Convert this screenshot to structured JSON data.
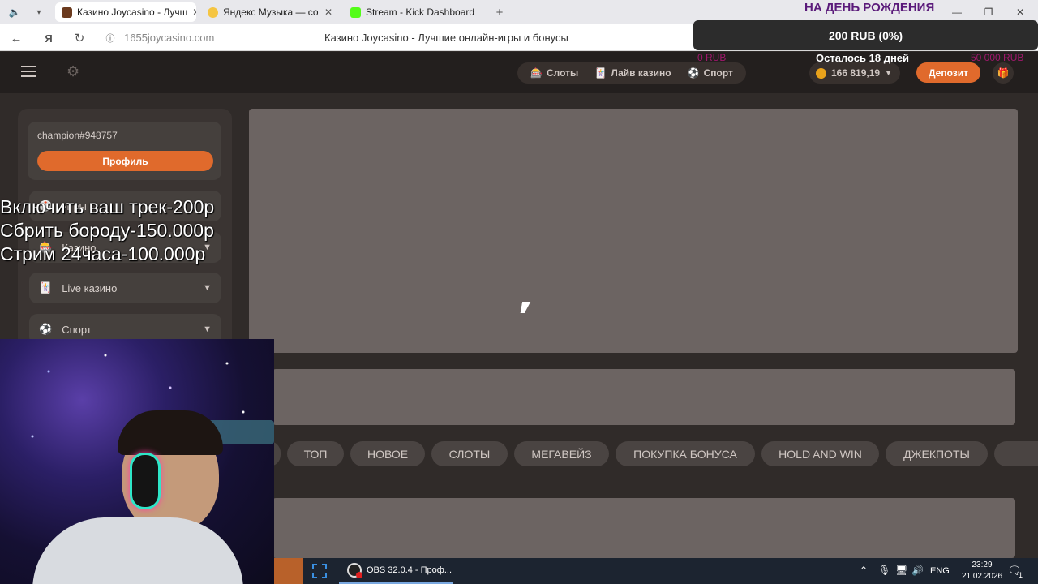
{
  "browser": {
    "tabs": [
      {
        "label": "Казино Joycasino - Лучш",
        "icon": "joycasino-icon",
        "active": true
      },
      {
        "label": "Яндекс Музыка — со",
        "icon": "yandex-music-icon",
        "active": false
      },
      {
        "label": "Stream - Kick Dashboard",
        "icon": "kick-icon",
        "active": false
      }
    ],
    "address": "1655joycasino.com",
    "page_title": "Казино Joycasino - Лучшие онлайн-игры и бонусы"
  },
  "overlay": {
    "birthday_label": "НА ДЕНЬ РОЖДЕНИЯ",
    "goal_amount": "200 RUB (0%)",
    "goal_min": "0 RUB",
    "goal_max": "50 000 RUB",
    "goal_progress": 0,
    "days_left": "Осталось 18 дней",
    "requests": [
      "Включить ваш трек-200р",
      "Сбрить бороду-150.000р",
      "Стрим 24часа-100.000р"
    ]
  },
  "header": {
    "nav": [
      {
        "label": "Слоты",
        "icon": "slots-icon"
      },
      {
        "label": "Лайв казино",
        "icon": "live-casino-icon"
      },
      {
        "label": "Спорт",
        "icon": "sport-icon"
      }
    ],
    "balance": "166 819,19",
    "deposit_label": "Депозит"
  },
  "sidebar": {
    "username": "champion#948757",
    "profile_button": "Профиль",
    "items": [
      {
        "label": "Игры",
        "icon": "games-icon"
      },
      {
        "label": "Казино",
        "icon": "casino-icon"
      },
      {
        "label": "Live казино",
        "icon": "live-casino-icon"
      },
      {
        "label": "Спорт",
        "icon": "sport-icon"
      }
    ]
  },
  "categories": [
    "ТОП",
    "НОВОЕ",
    "СЛОТЫ",
    "МЕГАВЕЙЗ",
    "ПОКУПКА БОНУСА",
    "HOLD AND WIN",
    "ДЖЕКПОТЫ"
  ],
  "taskbar": {
    "obs_label": "OBS 32.0.4 - Проф...",
    "lang": "ENG",
    "time": "23:29",
    "date": "21.02.2026",
    "notification_count": "1"
  }
}
